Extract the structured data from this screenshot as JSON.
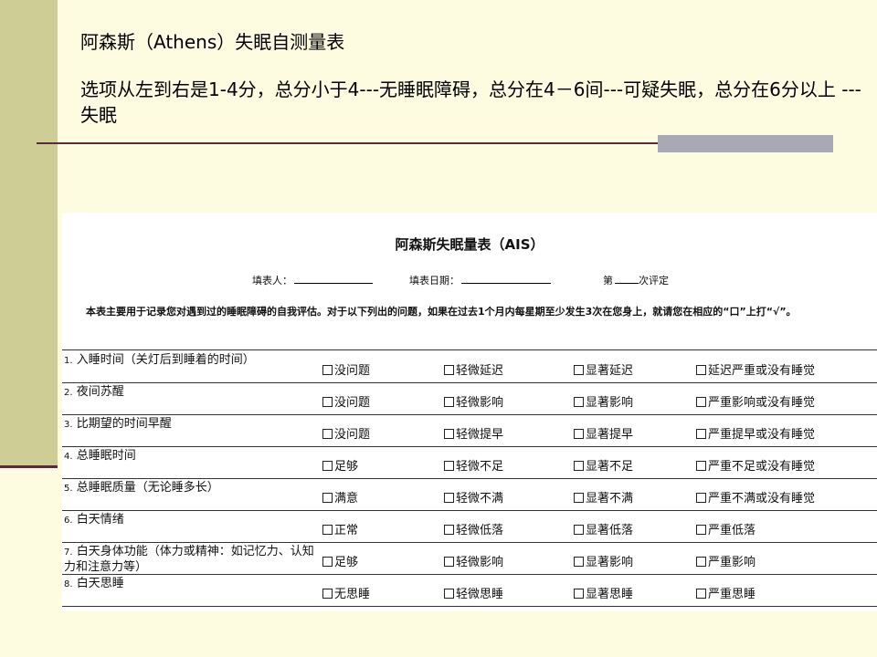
{
  "slide": {
    "title": "阿森斯（Athens）失眠自测量表",
    "description": "选项从左到右是1-4分，总分小于4---无睡眠障碍，总分在4－6间---可疑失眠，总分在6分以上 ---失眠"
  },
  "form": {
    "title": "阿森斯失眠量表（AIS）",
    "filler_label": "填表人：",
    "date_label": "填表日期：",
    "round_prefix": "第",
    "round_suffix": "次评定",
    "instructions": "本表主要用于记录您对遇到过的睡眠障碍的自我评估。对于以下列出的问题，如果在过去1个月内每星期至少发生3次在您身上，就请您在相应的“口”上打“√”。",
    "questions": [
      {
        "num": "1.",
        "text": "入睡时间（关灯后到睡着的时间）",
        "options": [
          "没问题",
          "轻微延迟",
          "显著延迟",
          "延迟严重或没有睡觉"
        ]
      },
      {
        "num": "2.",
        "text": "夜间苏醒",
        "options": [
          "没问题",
          "轻微影响",
          "显著影响",
          "严重影响或没有睡觉"
        ]
      },
      {
        "num": "3.",
        "text": "比期望的时间早醒",
        "options": [
          "没问题",
          "轻微提早",
          "显著提早",
          "严重提早或没有睡觉"
        ]
      },
      {
        "num": "4.",
        "text": "总睡眠时间",
        "options": [
          "足够",
          "轻微不足",
          "显著不足",
          "严重不足或没有睡觉"
        ]
      },
      {
        "num": "5.",
        "text": "总睡眠质量（无论睡多长）",
        "options": [
          "满意",
          "轻微不满",
          "显著不满",
          "严重不满或没有睡觉"
        ]
      },
      {
        "num": "6.",
        "text": "白天情绪",
        "options": [
          "正常",
          "轻微低落",
          "显著低落",
          "严重低落"
        ]
      },
      {
        "num": "7.",
        "text": "白天身体功能（体力或精神：如记忆力、认知力和注意力等）",
        "options": [
          "足够",
          "轻微影响",
          "显著影响",
          "严重影响"
        ]
      },
      {
        "num": "8.",
        "text": "白天思睡",
        "options": [
          "无思睡",
          "轻微思睡",
          "显著思睡",
          "严重思睡"
        ]
      }
    ]
  }
}
